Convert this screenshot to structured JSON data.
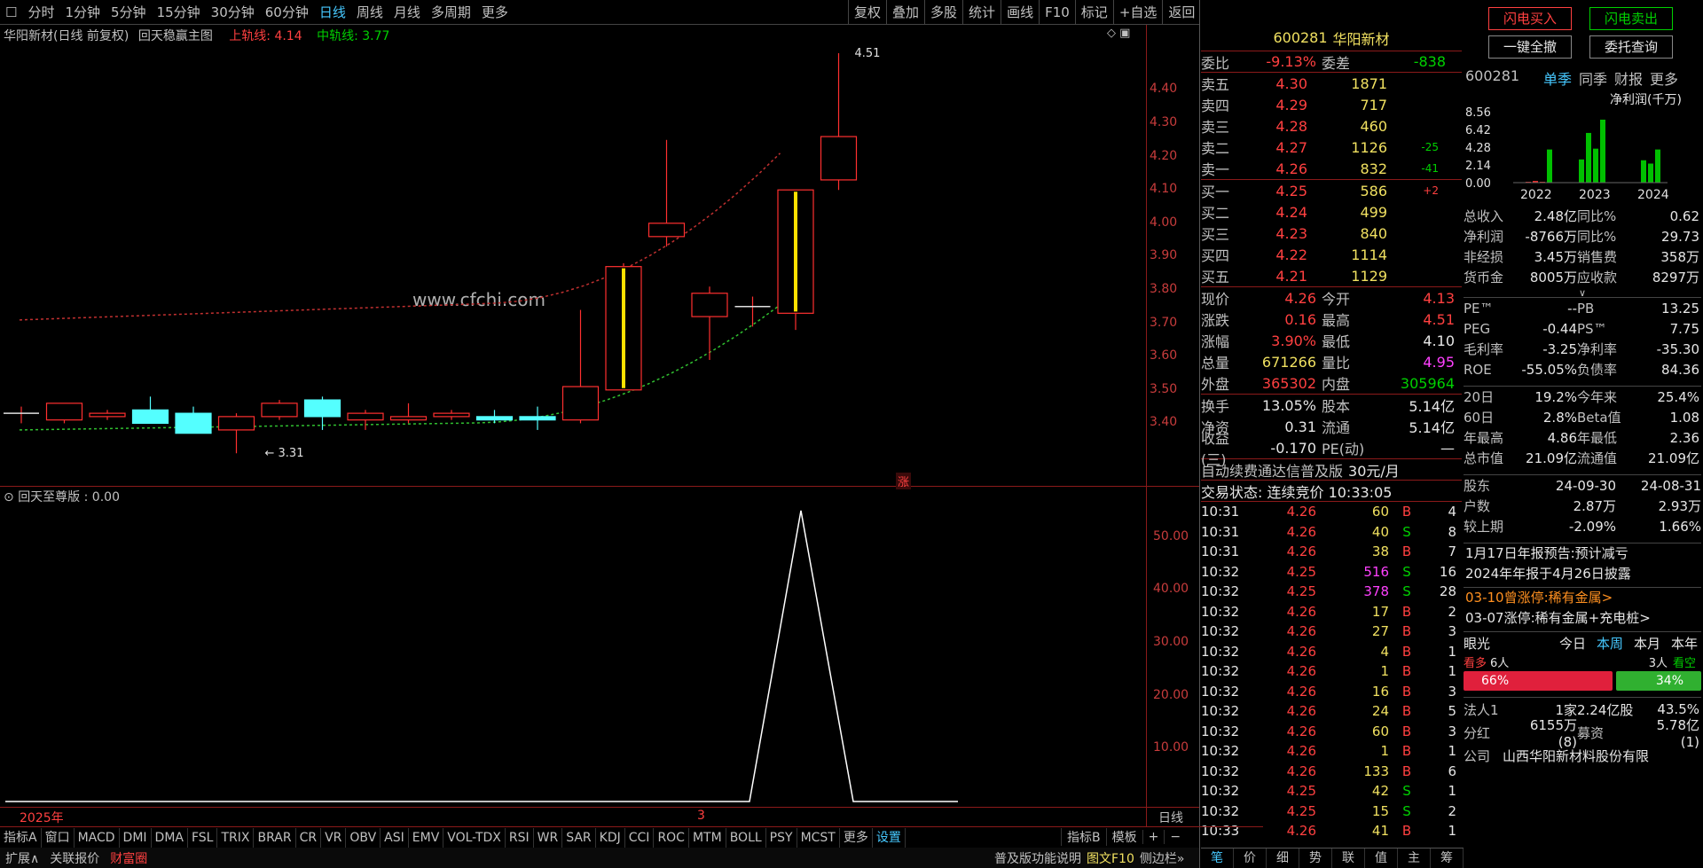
{
  "toolbar": {
    "tabs": [
      "分时",
      "1分钟",
      "5分钟",
      "15分钟",
      "30分钟",
      "60分钟",
      "日线",
      "周线",
      "月线",
      "多周期",
      "更多"
    ],
    "active": "日线",
    "right": [
      "复权",
      "叠加",
      "多股",
      "统计",
      "画线",
      "F10",
      "标记",
      "+自选",
      "返回"
    ]
  },
  "chart": {
    "title": "华阳新材(日线 前复权)",
    "indicator": "回天稳赢主图",
    "upper_label": "上轨线: 4.14",
    "mid_label": "中轨线: 3.77",
    "watermark": "www.cfchi.com",
    "high_mark": "4.51",
    "low_mark": "3.31",
    "zhang_badge": "涨",
    "y_ticks": [
      "4.40",
      "4.30",
      "4.20",
      "4.10",
      "4.00",
      "3.90",
      "3.80",
      "3.70",
      "3.60",
      "3.50",
      "3.40"
    ]
  },
  "chart_data": [
    {
      "type": "candlestick",
      "title": "华阳新材(日线 前复权)",
      "ylim": [
        3.3,
        4.55
      ],
      "candles": [
        {
          "o": 3.43,
          "h": 3.45,
          "l": 3.4,
          "c": 3.43
        },
        {
          "o": 3.41,
          "h": 3.46,
          "l": 3.4,
          "c": 3.46
        },
        {
          "o": 3.42,
          "h": 3.44,
          "l": 3.41,
          "c": 3.43
        },
        {
          "o": 3.44,
          "h": 3.48,
          "l": 3.4,
          "c": 3.4
        },
        {
          "o": 3.43,
          "h": 3.45,
          "l": 3.37,
          "c": 3.37
        },
        {
          "o": 3.38,
          "h": 3.43,
          "l": 3.31,
          "c": 3.42
        },
        {
          "o": 3.42,
          "h": 3.47,
          "l": 3.41,
          "c": 3.46
        },
        {
          "o": 3.47,
          "h": 3.48,
          "l": 3.38,
          "c": 3.42
        },
        {
          "o": 3.41,
          "h": 3.44,
          "l": 3.38,
          "c": 3.43
        },
        {
          "o": 3.41,
          "h": 3.46,
          "l": 3.4,
          "c": 3.42
        },
        {
          "o": 3.42,
          "h": 3.44,
          "l": 3.41,
          "c": 3.43
        },
        {
          "o": 3.42,
          "h": 3.44,
          "l": 3.4,
          "c": 3.41
        },
        {
          "o": 3.42,
          "h": 3.45,
          "l": 3.38,
          "c": 3.41
        },
        {
          "o": 3.41,
          "h": 3.74,
          "l": 3.4,
          "c": 3.51
        },
        {
          "o": 3.5,
          "h": 3.88,
          "l": 3.5,
          "c": 3.87
        },
        {
          "o": 3.96,
          "h": 4.25,
          "l": 3.93,
          "c": 4.0
        },
        {
          "o": 3.72,
          "h": 3.81,
          "l": 3.59,
          "c": 3.79
        },
        {
          "o": 3.75,
          "h": 3.78,
          "l": 3.69,
          "c": 3.75
        },
        {
          "o": 3.73,
          "h": 4.1,
          "l": 3.68,
          "c": 4.1
        },
        {
          "o": 4.13,
          "h": 4.51,
          "l": 4.1,
          "c": 4.26
        }
      ]
    },
    {
      "type": "line",
      "title": "回天至尊版 : 0.00",
      "ylim": [
        0,
        57
      ],
      "y_ticks": [
        "50.00",
        "40.00",
        "30.00",
        "20.00",
        "10.00"
      ],
      "series": [
        {
          "values": [
            0,
            0,
            0,
            0,
            0,
            0,
            0,
            0,
            0,
            0,
            0,
            0,
            0,
            0,
            0,
            0,
            0,
            0,
            0,
            0,
            0,
            0,
            0,
            0,
            0,
            0,
            0,
            0,
            0,
            0,
            0,
            0,
            0,
            0,
            0,
            0,
            0,
            0,
            0,
            0,
            0,
            0,
            0,
            0,
            0,
            0,
            0,
            0,
            0,
            0,
            0,
            0,
            0,
            0,
            0,
            0,
            0,
            0,
            55,
            0,
            0,
            0,
            0,
            0,
            0,
            0,
            0,
            0,
            0,
            0
          ]
        }
      ]
    }
  ],
  "sub": {
    "title": "回天至尊版 : 0.00",
    "x_labels": [
      "2025年",
      "3"
    ]
  },
  "quote": {
    "code": "600281",
    "name": "华阳新材",
    "weibi_label": "委比",
    "weibi": "-9.13%",
    "weicha_label": "委差",
    "weicha": "-838",
    "asks": [
      [
        "卖五",
        "4.30",
        "1871",
        ""
      ],
      [
        "卖四",
        "4.29",
        "717",
        ""
      ],
      [
        "卖三",
        "4.28",
        "460",
        ""
      ],
      [
        "卖二",
        "4.27",
        "1126",
        "-25"
      ],
      [
        "卖一",
        "4.26",
        "832",
        "-41"
      ]
    ],
    "bids": [
      [
        "买一",
        "4.25",
        "586",
        "+2"
      ],
      [
        "买二",
        "4.24",
        "499",
        ""
      ],
      [
        "买三",
        "4.23",
        "840",
        ""
      ],
      [
        "买四",
        "4.22",
        "1114",
        ""
      ],
      [
        "买五",
        "4.21",
        "1129",
        ""
      ]
    ],
    "stats": [
      [
        "现价",
        "4.26",
        "今开",
        "4.13"
      ],
      [
        "涨跌",
        "0.16",
        "最高",
        "4.51"
      ],
      [
        "涨幅",
        "3.90%",
        "最低",
        "4.10"
      ],
      [
        "总量",
        "671266",
        "量比",
        "4.95"
      ],
      [
        "外盘",
        "365302",
        "内盘",
        "305964"
      ]
    ],
    "stats2": [
      [
        "换手",
        "13.05%",
        "股本",
        "5.14亿"
      ],
      [
        "净资",
        "0.31",
        "流通",
        "5.14亿"
      ],
      [
        "收益(三)",
        "-0.170",
        "PE(动)",
        "—"
      ]
    ],
    "ad": "自动续费通达信普及版",
    "ad_price": "30元/月",
    "status": "交易状态: 连续竞价 10:33:05",
    "ticks": [
      [
        "10:31",
        "4.26",
        "60",
        "B",
        "4"
      ],
      [
        "10:31",
        "4.26",
        "40",
        "S",
        "8"
      ],
      [
        "10:31",
        "4.26",
        "38",
        "B",
        "7"
      ],
      [
        "10:32",
        "4.25",
        "516",
        "S",
        "16"
      ],
      [
        "10:32",
        "4.25",
        "378",
        "S",
        "28"
      ],
      [
        "10:32",
        "4.26",
        "17",
        "B",
        "2"
      ],
      [
        "10:32",
        "4.26",
        "27",
        "B",
        "3"
      ],
      [
        "10:32",
        "4.26",
        "4",
        "B",
        "1"
      ],
      [
        "10:32",
        "4.26",
        "1",
        "B",
        "1"
      ],
      [
        "10:32",
        "4.26",
        "16",
        "B",
        "3"
      ],
      [
        "10:32",
        "4.26",
        "24",
        "B",
        "5"
      ],
      [
        "10:32",
        "4.26",
        "60",
        "B",
        "3"
      ],
      [
        "10:32",
        "4.26",
        "1",
        "B",
        "1"
      ],
      [
        "10:32",
        "4.26",
        "133",
        "B",
        "6"
      ],
      [
        "10:32",
        "4.25",
        "42",
        "S",
        "1"
      ],
      [
        "10:32",
        "4.25",
        "15",
        "S",
        "2"
      ],
      [
        "10:33",
        "4.26",
        "41",
        "B",
        "1"
      ]
    ],
    "bottom_tabs": [
      "笔",
      "价",
      "细",
      "势",
      "联",
      "值",
      "主",
      "筹"
    ]
  },
  "fin": {
    "buy_btn": "闪电买入",
    "sell_btn": "闪电卖出",
    "cancel_btn": "一键全撤",
    "query_btn": "委托查询",
    "code": "600281",
    "tabs": [
      "单季",
      "同季",
      "财报",
      "更多"
    ],
    "chart_title": "净利润(千万)",
    "y": [
      "8.56",
      "6.42",
      "4.28",
      "2.14",
      "0.00"
    ],
    "years": [
      "2022",
      "2023",
      "2024"
    ],
    "rows1": [
      [
        "总收入",
        "2.48亿",
        "同比%",
        "0.62"
      ],
      [
        "净利润",
        "-8766万",
        "同比%",
        "29.73"
      ],
      [
        "非经损",
        "3.45万",
        "销售费",
        "358万"
      ],
      [
        "货币金",
        "8005万",
        "应收款",
        "8297万"
      ]
    ],
    "rows2": [
      [
        "PE™",
        "--",
        "PB",
        "13.25"
      ],
      [
        "PEG",
        "-0.44",
        "PS™",
        "7.75"
      ],
      [
        "毛利率",
        "-3.25",
        "净利率",
        "-35.30"
      ],
      [
        "ROE",
        "-55.05%",
        "负债率",
        "84.36"
      ]
    ],
    "rows3": [
      [
        "20日",
        "19.2%",
        "今年来",
        "25.4%"
      ],
      [
        "60日",
        "2.8%",
        "Beta值",
        "1.08"
      ],
      [
        "年最高",
        "4.86",
        "年最低",
        "2.36"
      ],
      [
        "总市值",
        "21.09亿",
        "流通值",
        "21.09亿"
      ]
    ],
    "rows4": [
      [
        "股东",
        "24-09-30",
        "24-08-31"
      ],
      [
        "户数",
        "2.87万",
        "2.93万"
      ],
      [
        "较上期",
        "-2.09%",
        "1.66%"
      ]
    ],
    "news": [
      "1月17日年报预告:预计减亏",
      "2024年年报于4月26日披露"
    ],
    "news2": [
      "03-10曾涨停:稀有金属>",
      "03-07涨停:稀有金属+充电桩>"
    ],
    "yanguang": "眼光",
    "periods": [
      "今日",
      "本周",
      "本月",
      "本年"
    ],
    "bull": "看多",
    "bull_n": "6人",
    "bear_n": "3人",
    "bear": "看空",
    "bull_pct": "66%",
    "bear_pct": "34%",
    "faren": [
      "法人1",
      "1家",
      "2.24亿股",
      "43.5%"
    ],
    "fenhong": [
      "分红",
      "6155万(8)",
      "募资",
      "5.78亿(1)"
    ],
    "company_label": "公司",
    "company": "山西华阳新材料股份有限"
  },
  "bottom": {
    "tabs": [
      "指标A",
      "窗口",
      "MACD",
      "DMI",
      "DMA",
      "FSL",
      "TRIX",
      "BRAR",
      "CR",
      "VR",
      "OBV",
      "ASI",
      "EMV",
      "VOL-TDX",
      "RSI",
      "WR",
      "SAR",
      "KDJ",
      "CCI",
      "ROC",
      "MTM",
      "BOLL",
      "PSY",
      "MCST",
      "更多",
      "设置"
    ],
    "right": [
      "指标B",
      "模板",
      "+",
      "−"
    ],
    "daily": "日线"
  },
  "status": {
    "items": [
      "扩展∧",
      "关联报价",
      "财富圈"
    ],
    "right": [
      "普及版功能说明",
      "图文F10",
      "侧边栏»"
    ]
  },
  "colors": {
    "up": "#ff3030",
    "down": "#54ffff",
    "upper": "#c03030",
    "mid": "#30c030"
  }
}
